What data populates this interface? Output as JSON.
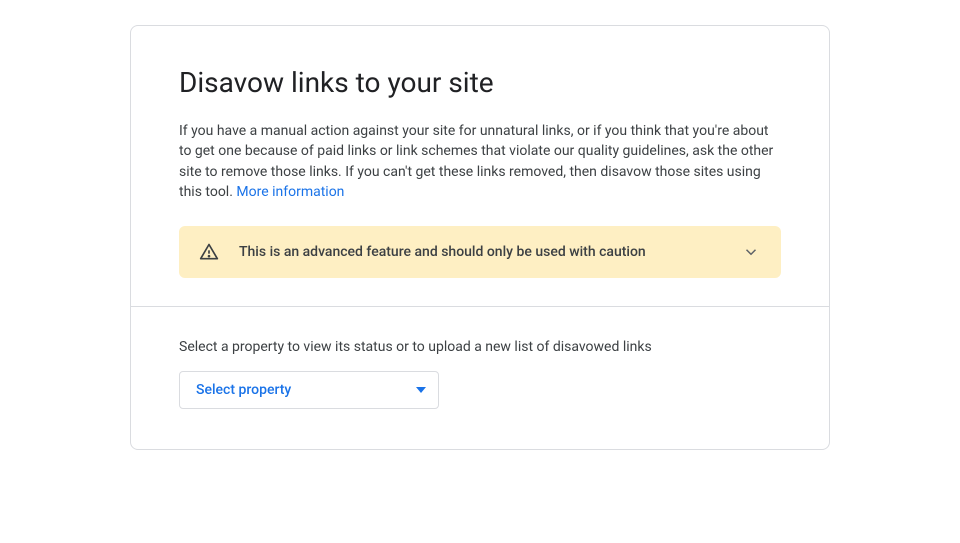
{
  "header": {
    "title": "Disavow links to your site",
    "description": "If you have a manual action against your site for unnatural links, or if you think that you're about to get one because of paid links or link schemes that violate our quality guidelines, ask the other site to remove those links. If you can't get these links removed, then disavow those sites using this tool. ",
    "more_link": "More information"
  },
  "warning": {
    "text": "This is an advanced feature and should only be used with caution"
  },
  "property_section": {
    "label": "Select a property to view its status or to upload a new list of disavowed links",
    "select_label": "Select property"
  }
}
